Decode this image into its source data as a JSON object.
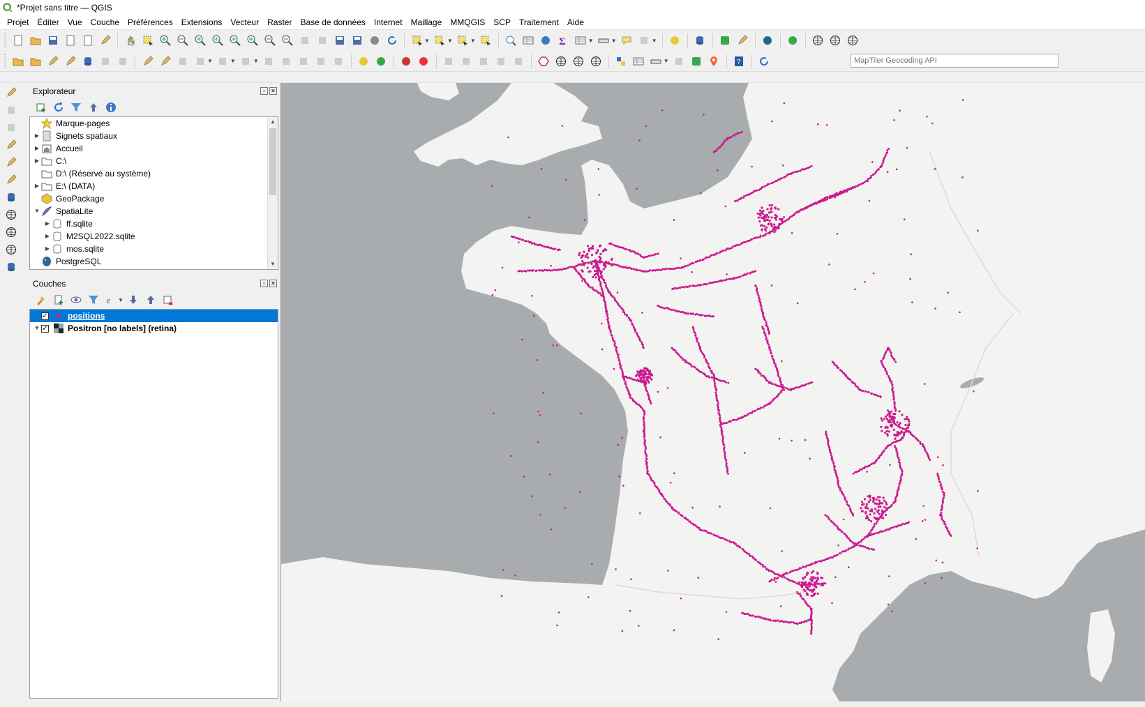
{
  "window": {
    "title": "*Projet sans titre — QGIS"
  },
  "menu": [
    "Projet",
    "Éditer",
    "Vue",
    "Couche",
    "Préférences",
    "Extensions",
    "Vecteur",
    "Raster",
    "Base de données",
    "Internet",
    "Maillage",
    "MMQGIS",
    "SCP",
    "Traitement",
    "Aide"
  ],
  "search": {
    "placeholder": "MapTiler Geocoding API"
  },
  "browser": {
    "title": "Explorateur",
    "items": [
      {
        "label": "Marque-pages",
        "icon": "star-icon",
        "expandable": false,
        "indent": 0
      },
      {
        "label": "Signets spatiaux",
        "icon": "spatial-bookmarks-icon",
        "expandable": true,
        "indent": 0
      },
      {
        "label": "Accueil",
        "icon": "home-folder-icon",
        "expandable": true,
        "indent": 0
      },
      {
        "label": "C:\\",
        "icon": "folder-icon",
        "expandable": true,
        "indent": 0
      },
      {
        "label": "D:\\ (Réservé au système)",
        "icon": "folder-icon",
        "expandable": false,
        "indent": 0
      },
      {
        "label": "E:\\ (DATA)",
        "icon": "folder-icon",
        "expandable": true,
        "indent": 0
      },
      {
        "label": "GeoPackage",
        "icon": "geopackage-icon",
        "expandable": false,
        "indent": 0
      },
      {
        "label": "SpatiaLite",
        "icon": "spatialite-icon",
        "expandable": true,
        "expanded": true,
        "indent": 0
      },
      {
        "label": "ff.sqlite",
        "icon": "database-icon",
        "expandable": true,
        "indent": 1
      },
      {
        "label": "M2SQL2022.sqlite",
        "icon": "database-icon",
        "expandable": true,
        "indent": 1
      },
      {
        "label": "mos.sqlite",
        "icon": "database-icon",
        "expandable": true,
        "indent": 1
      },
      {
        "label": "PostgreSQL",
        "icon": "postgresql-icon",
        "expandable": false,
        "indent": 0
      }
    ]
  },
  "layers": {
    "title": "Couches",
    "items": [
      {
        "label": "positions",
        "checked": true,
        "selected": true,
        "icon": "point-layer-icon"
      },
      {
        "label": "Positron [no labels] (retina)",
        "checked": true,
        "selected": false,
        "icon": "raster-tile-icon"
      }
    ]
  },
  "colors": {
    "points": "#cc1a8e",
    "land": "#f3f3f1",
    "water": "#a9acae",
    "selection": "#0078d7"
  }
}
